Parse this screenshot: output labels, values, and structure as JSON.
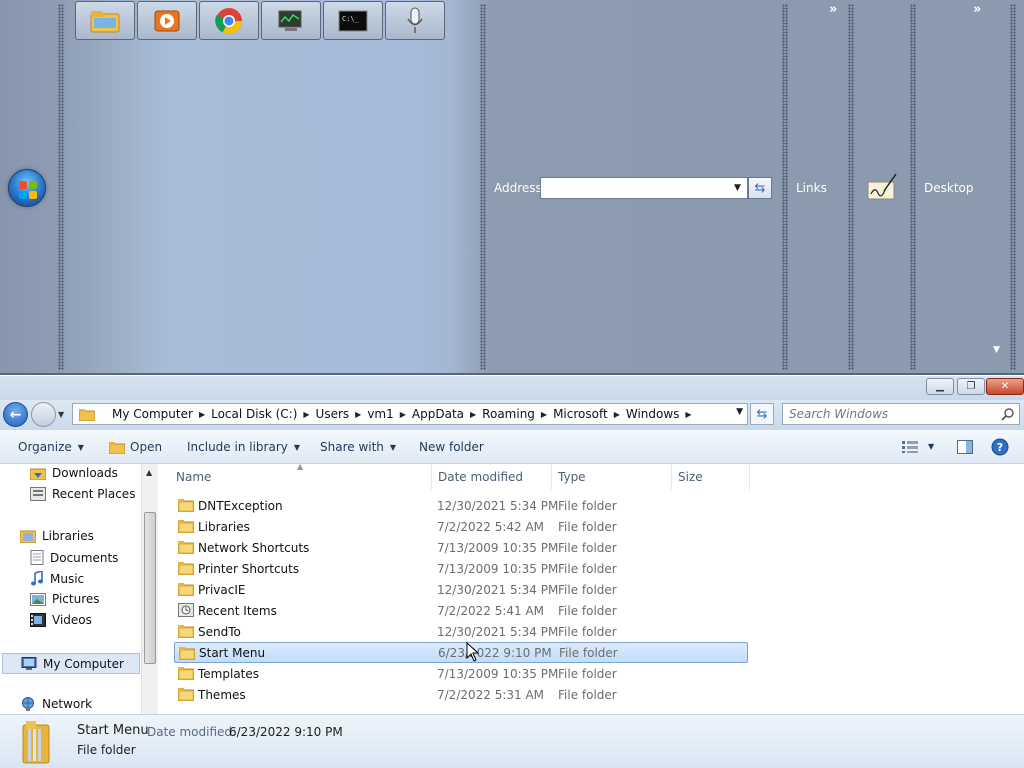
{
  "taskbar": {
    "quick_launch": [
      {
        "icon": "folder-explorer-icon"
      },
      {
        "icon": "media-player-icon"
      },
      {
        "icon": "chrome-icon"
      },
      {
        "icon": "network-monitor-icon"
      },
      {
        "icon": "command-prompt-icon"
      },
      {
        "icon": "microphone-icon"
      }
    ],
    "address_label": "Address",
    "address_value": "",
    "links_label": "Links",
    "desktop_label": "Desktop",
    "chevron": "»"
  },
  "explorer": {
    "breadcrumb": [
      "My Computer",
      "Local Disk (C:)",
      "Users",
      "vm1",
      "AppData",
      "Roaming",
      "Microsoft",
      "Windows"
    ],
    "search_placeholder": "Search Windows",
    "toolbar": {
      "organize": "Organize",
      "open": "Open",
      "include_in_library": "Include in library",
      "share_with": "Share with",
      "new_folder": "New folder"
    },
    "sidebar": {
      "downloads": "Downloads",
      "recent_places": "Recent Places",
      "libraries": "Libraries",
      "documents": "Documents",
      "music": "Music",
      "pictures": "Pictures",
      "videos": "Videos",
      "my_computer": "My Computer",
      "network": "Network"
    },
    "columns": {
      "name": "Name",
      "date_modified": "Date modified",
      "type": "Type",
      "size": "Size"
    },
    "files": [
      {
        "name": "DNTException",
        "date": "12/30/2021 5:34 PM",
        "type": "File folder",
        "icon": "folder-icon"
      },
      {
        "name": "Libraries",
        "date": "7/2/2022 5:42 AM",
        "type": "File folder",
        "icon": "folder-icon"
      },
      {
        "name": "Network Shortcuts",
        "date": "7/13/2009 10:35 PM",
        "type": "File folder",
        "icon": "folder-icon"
      },
      {
        "name": "Printer Shortcuts",
        "date": "7/13/2009 10:35 PM",
        "type": "File folder",
        "icon": "folder-icon"
      },
      {
        "name": "PrivacIE",
        "date": "12/30/2021 5:34 PM",
        "type": "File folder",
        "icon": "folder-icon"
      },
      {
        "name": "Recent Items",
        "date": "7/2/2022 5:41 AM",
        "type": "File folder",
        "icon": "recent-items-icon"
      },
      {
        "name": "SendTo",
        "date": "12/30/2021 5:34 PM",
        "type": "File folder",
        "icon": "folder-icon"
      },
      {
        "name": "Start Menu",
        "date": "6/23/2022 9:10 PM",
        "type": "File folder",
        "icon": "folder-icon",
        "selected": true
      },
      {
        "name": "Templates",
        "date": "7/13/2009 10:35 PM",
        "type": "File folder",
        "icon": "folder-icon"
      },
      {
        "name": "Themes",
        "date": "7/2/2022 5:31 AM",
        "type": "File folder",
        "icon": "folder-icon"
      }
    ],
    "details": {
      "name": "Start Menu",
      "modified_label": "Date modified:",
      "modified_value": "6/23/2022 9:10 PM",
      "type": "File folder"
    }
  },
  "colors": {
    "taskbar_gray": "#8c9ab0",
    "selection_blue": "#c1dcfb",
    "link_blue": "#1e395b"
  }
}
